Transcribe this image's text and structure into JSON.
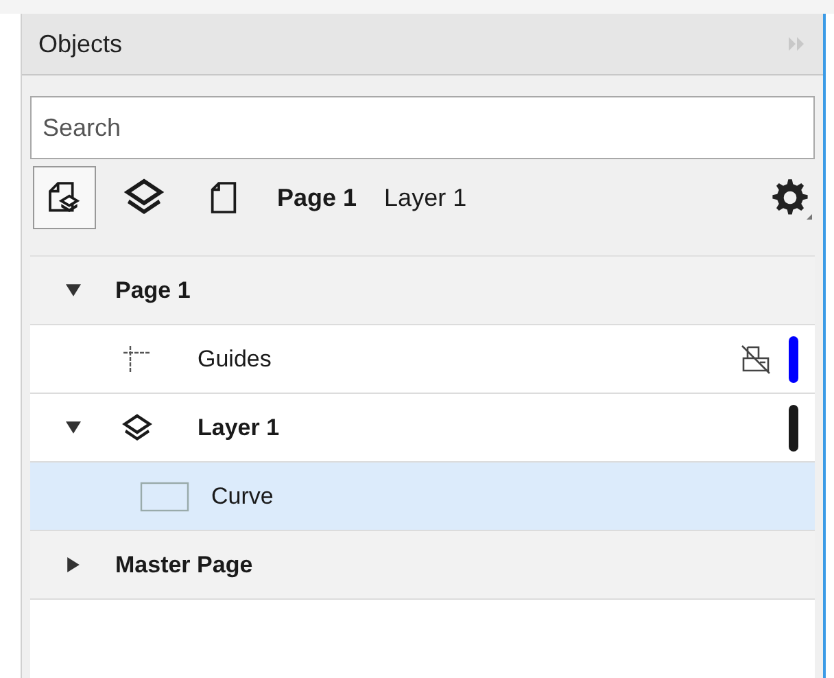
{
  "panel": {
    "title": "Objects"
  },
  "search": {
    "placeholder": "Search"
  },
  "toolbar": {
    "buttons": [
      {
        "kind": "page-layers",
        "selected": true
      },
      {
        "kind": "layers",
        "selected": false
      },
      {
        "kind": "page",
        "selected": false
      }
    ],
    "current_page": "Page 1",
    "current_layer": "Layer 1"
  },
  "tree": [
    {
      "kind": "page",
      "label": "Page 1",
      "expanded": true,
      "selected": false,
      "children": [
        {
          "kind": "guides",
          "label": "Guides",
          "selected": false,
          "color": "#0000ff"
        },
        {
          "kind": "layer",
          "label": "Layer 1",
          "expanded": true,
          "selected": false,
          "color": "#1a1a1a",
          "children": [
            {
              "kind": "object",
              "label": "Curve",
              "selected": true
            }
          ]
        }
      ]
    },
    {
      "kind": "page",
      "label": "Master Page",
      "expanded": false,
      "selected": false
    }
  ]
}
